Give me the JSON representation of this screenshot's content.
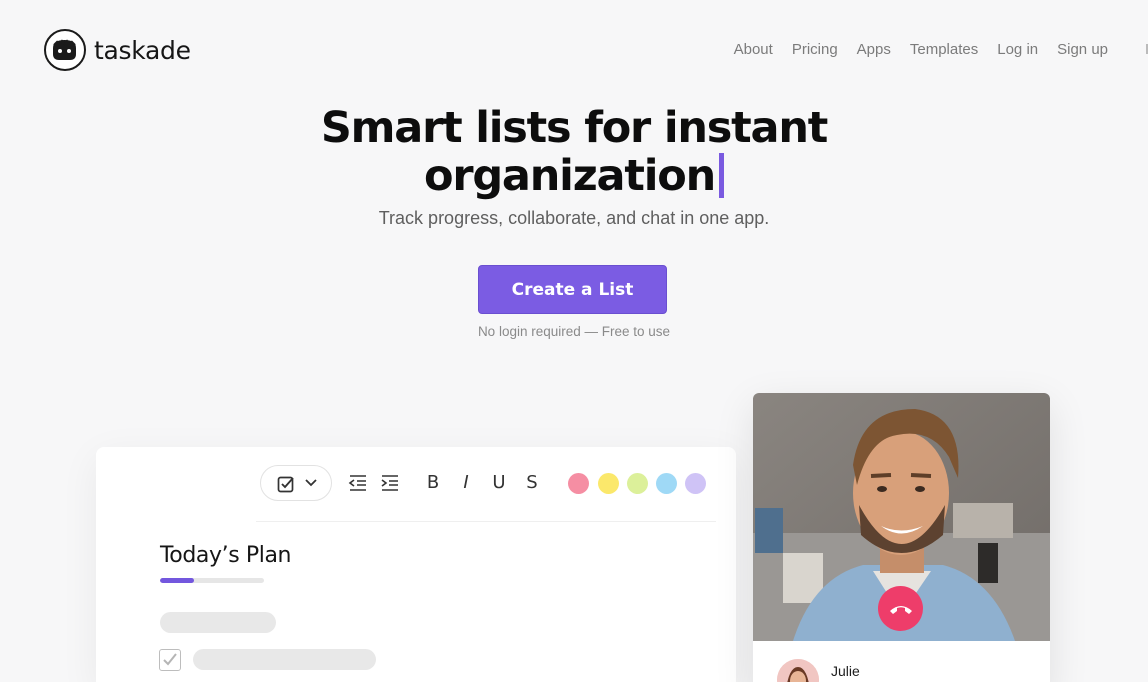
{
  "brand": {
    "name": "taskade",
    "accent": "#7b5ce3"
  },
  "nav": [
    "About",
    "Pricing",
    "Apps",
    "Templates",
    "Log in",
    "Sign up"
  ],
  "hero": {
    "title_line1": "Smart lists for instant",
    "title_line2": "organization",
    "subtitle": "Track progress, collaborate, and chat in one app.",
    "cta": "Create a List",
    "cta_note": "No login required — Free to use"
  },
  "editor": {
    "toolbar": {
      "format_letters": [
        "B",
        "I",
        "U",
        "S"
      ],
      "colors": [
        "#f58ea3",
        "#fbe86b",
        "#dcf09a",
        "#9fd9f6",
        "#cfc3f6"
      ]
    },
    "plan_title": "Today’s Plan",
    "progress": 0.33
  },
  "video_call": {
    "caller_name": "Julie"
  }
}
